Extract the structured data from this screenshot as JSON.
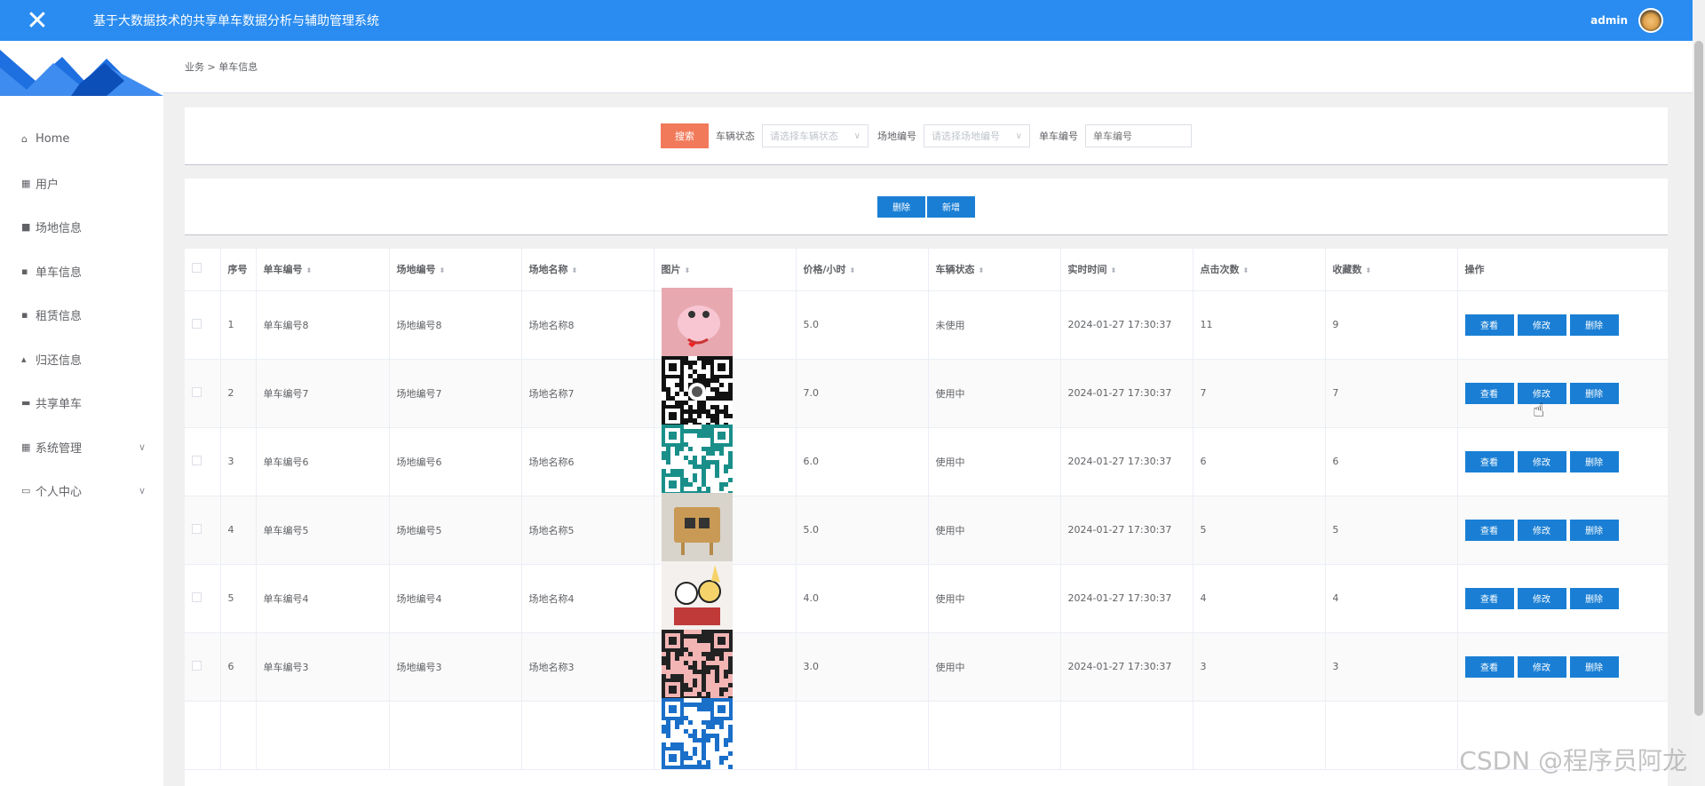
{
  "app": {
    "title": "基于大数据技术的共享单车数据分析与辅助管理系统",
    "user": "admin"
  },
  "sidebar": {
    "items": [
      {
        "icon": "home-icon",
        "glyph": "⌂",
        "label": "Home"
      },
      {
        "icon": "grid-icon",
        "glyph": "▦",
        "label": "用户"
      },
      {
        "icon": "briefcase-icon",
        "glyph": "■",
        "label": "场地信息"
      },
      {
        "icon": "clipboard-icon",
        "glyph": "▪",
        "label": "单车信息"
      },
      {
        "icon": "clipboard-icon",
        "glyph": "▪",
        "label": "租赁信息"
      },
      {
        "icon": "thumb-icon",
        "glyph": "▴",
        "label": "归还信息"
      },
      {
        "icon": "bus-icon",
        "glyph": "▬",
        "label": "共享单车"
      },
      {
        "icon": "grid-icon",
        "glyph": "▦",
        "label": "系统管理",
        "expandable": true
      },
      {
        "icon": "card-icon",
        "glyph": "▭",
        "label": "个人中心",
        "expandable": true
      }
    ]
  },
  "breadcrumb": "业务 > 单车信息",
  "search": {
    "button": "搜索",
    "status_label": "车辆状态",
    "status_placeholder": "请选择车辆状态",
    "site_label": "场地编号",
    "site_placeholder": "请选择场地编号",
    "bike_label": "单车编号",
    "bike_placeholder": "单车编号"
  },
  "actions": {
    "delete": "删除",
    "add": "新增"
  },
  "table": {
    "headers": [
      "序号",
      "单车编号",
      "场地编号",
      "场地名称",
      "图片",
      "价格/小时",
      "车辆状态",
      "实时时间",
      "点击次数",
      "收藏数",
      "操作"
    ],
    "row_buttons": {
      "view": "查看",
      "edit": "修改",
      "delete": "删除"
    },
    "rows": [
      {
        "idx": "1",
        "bike": "单车编号8",
        "site": "场地编号8",
        "name": "场地名称8",
        "img": "pink-cartoon",
        "price": "5.0",
        "status": "未使用",
        "time": "2024-01-27 17:30:37",
        "clicks": "11",
        "fav": "9"
      },
      {
        "idx": "2",
        "bike": "单车编号7",
        "site": "场地编号7",
        "name": "场地名称7",
        "img": "qr-black",
        "price": "7.0",
        "status": "使用中",
        "time": "2024-01-27 17:30:37",
        "clicks": "7",
        "fav": "7"
      },
      {
        "idx": "3",
        "bike": "单车编号6",
        "site": "场地编号6",
        "name": "场地名称6",
        "img": "qr-teal",
        "price": "6.0",
        "status": "使用中",
        "time": "2024-01-27 17:30:37",
        "clicks": "6",
        "fav": "6"
      },
      {
        "idx": "4",
        "bike": "单车编号5",
        "site": "场地编号5",
        "name": "场地名称5",
        "img": "wood-sign",
        "price": "5.0",
        "status": "使用中",
        "time": "2024-01-27 17:30:37",
        "clicks": "5",
        "fav": "5"
      },
      {
        "idx": "5",
        "bike": "单车编号4",
        "site": "场地编号4",
        "name": "场地名称4",
        "img": "cartoon-couple",
        "price": "4.0",
        "status": "使用中",
        "time": "2024-01-27 17:30:37",
        "clicks": "4",
        "fav": "4"
      },
      {
        "idx": "6",
        "bike": "单车编号3",
        "site": "场地编号3",
        "name": "场地名称3",
        "img": "qr-pink",
        "price": "3.0",
        "status": "使用中",
        "time": "2024-01-27 17:30:37",
        "clicks": "3",
        "fav": "3"
      },
      {
        "idx": "",
        "bike": "",
        "site": "",
        "name": "",
        "img": "qr-blue",
        "price": "",
        "status": "",
        "time": "",
        "clicks": "",
        "fav": ""
      }
    ]
  },
  "watermark": "CSDN @程序员阿龙",
  "colors": {
    "topbar": "#2a8cf0",
    "search_button": "#f17a5a",
    "action_button": "#1a7fd4"
  }
}
